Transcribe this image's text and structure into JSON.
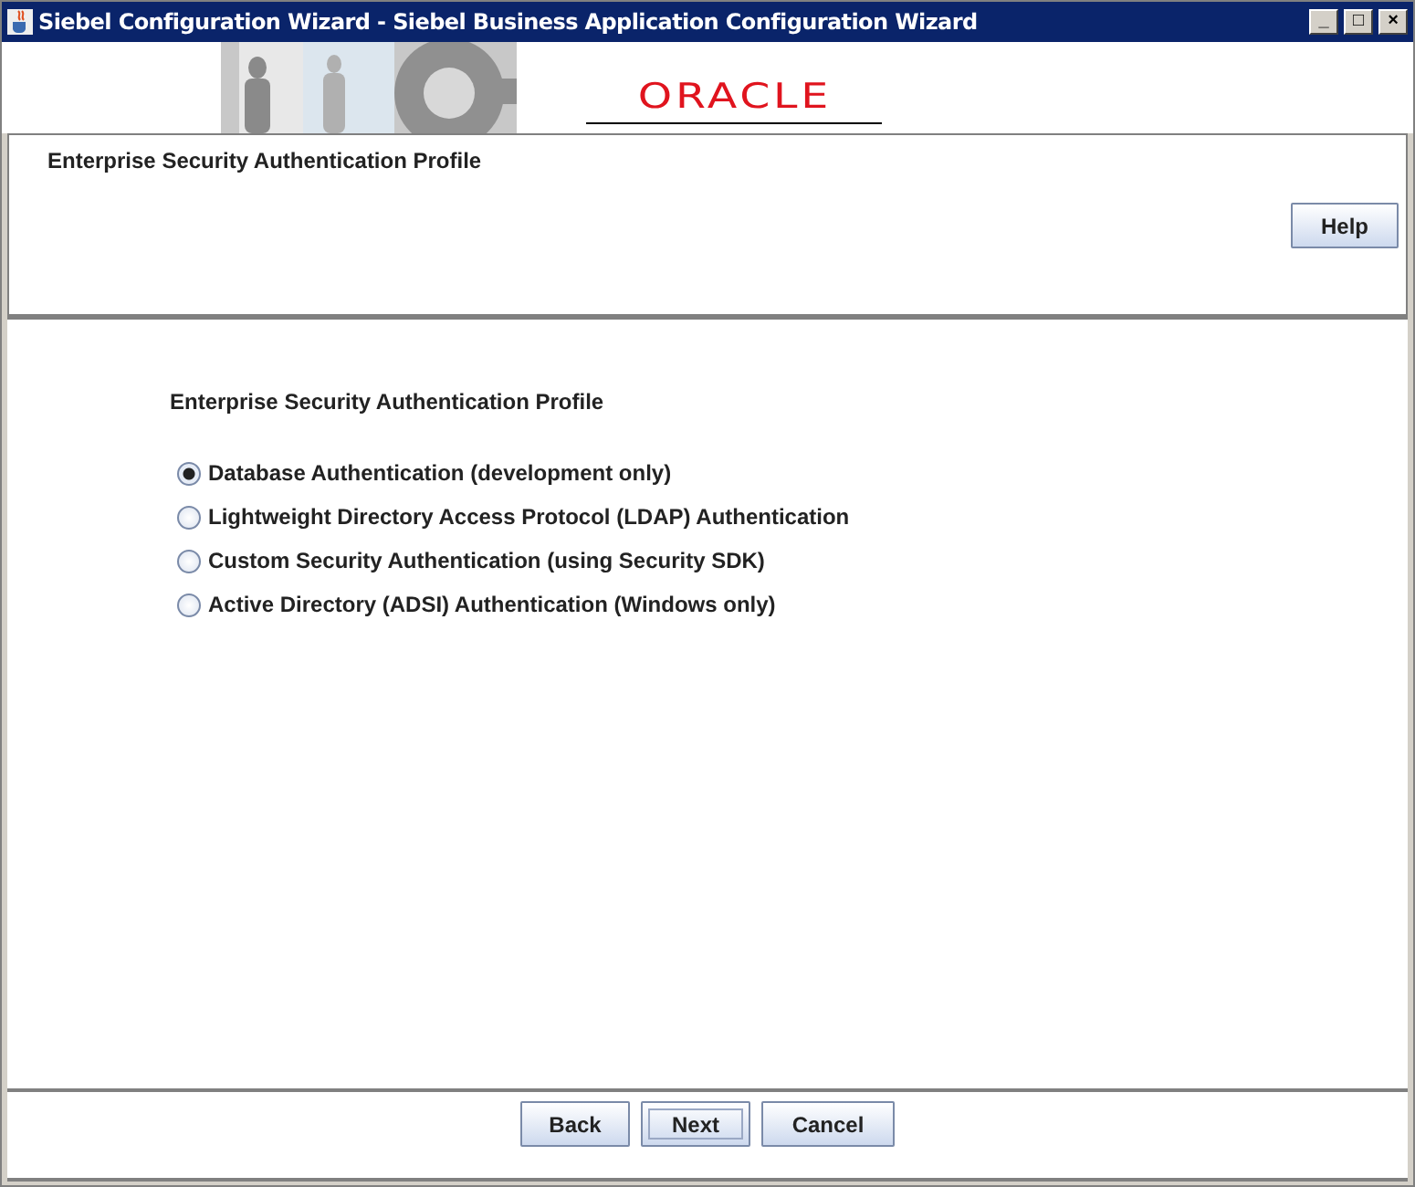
{
  "window": {
    "title": "Siebel Configuration Wizard - Siebel Business Application Configuration Wizard",
    "controls": [
      "_",
      "□",
      "×"
    ]
  },
  "banner": {
    "logo": "ORACLE"
  },
  "header": {
    "title": "Enterprise Security Authentication Profile",
    "help_button": "Help"
  },
  "content": {
    "heading": "Enterprise Security Authentication Profile",
    "options": [
      {
        "label": "Database Authentication (development only)",
        "selected": true
      },
      {
        "label": "Lightweight Directory Access Protocol (LDAP) Authentication",
        "selected": false
      },
      {
        "label": "Custom Security Authentication (using Security SDK)",
        "selected": false
      },
      {
        "label": "Active Directory (ADSI) Authentication (Windows only)",
        "selected": false
      }
    ]
  },
  "buttons": [
    {
      "label": "Back",
      "focused": false
    },
    {
      "label": "Next",
      "focused": true
    },
    {
      "label": "Cancel",
      "focused": false
    }
  ]
}
